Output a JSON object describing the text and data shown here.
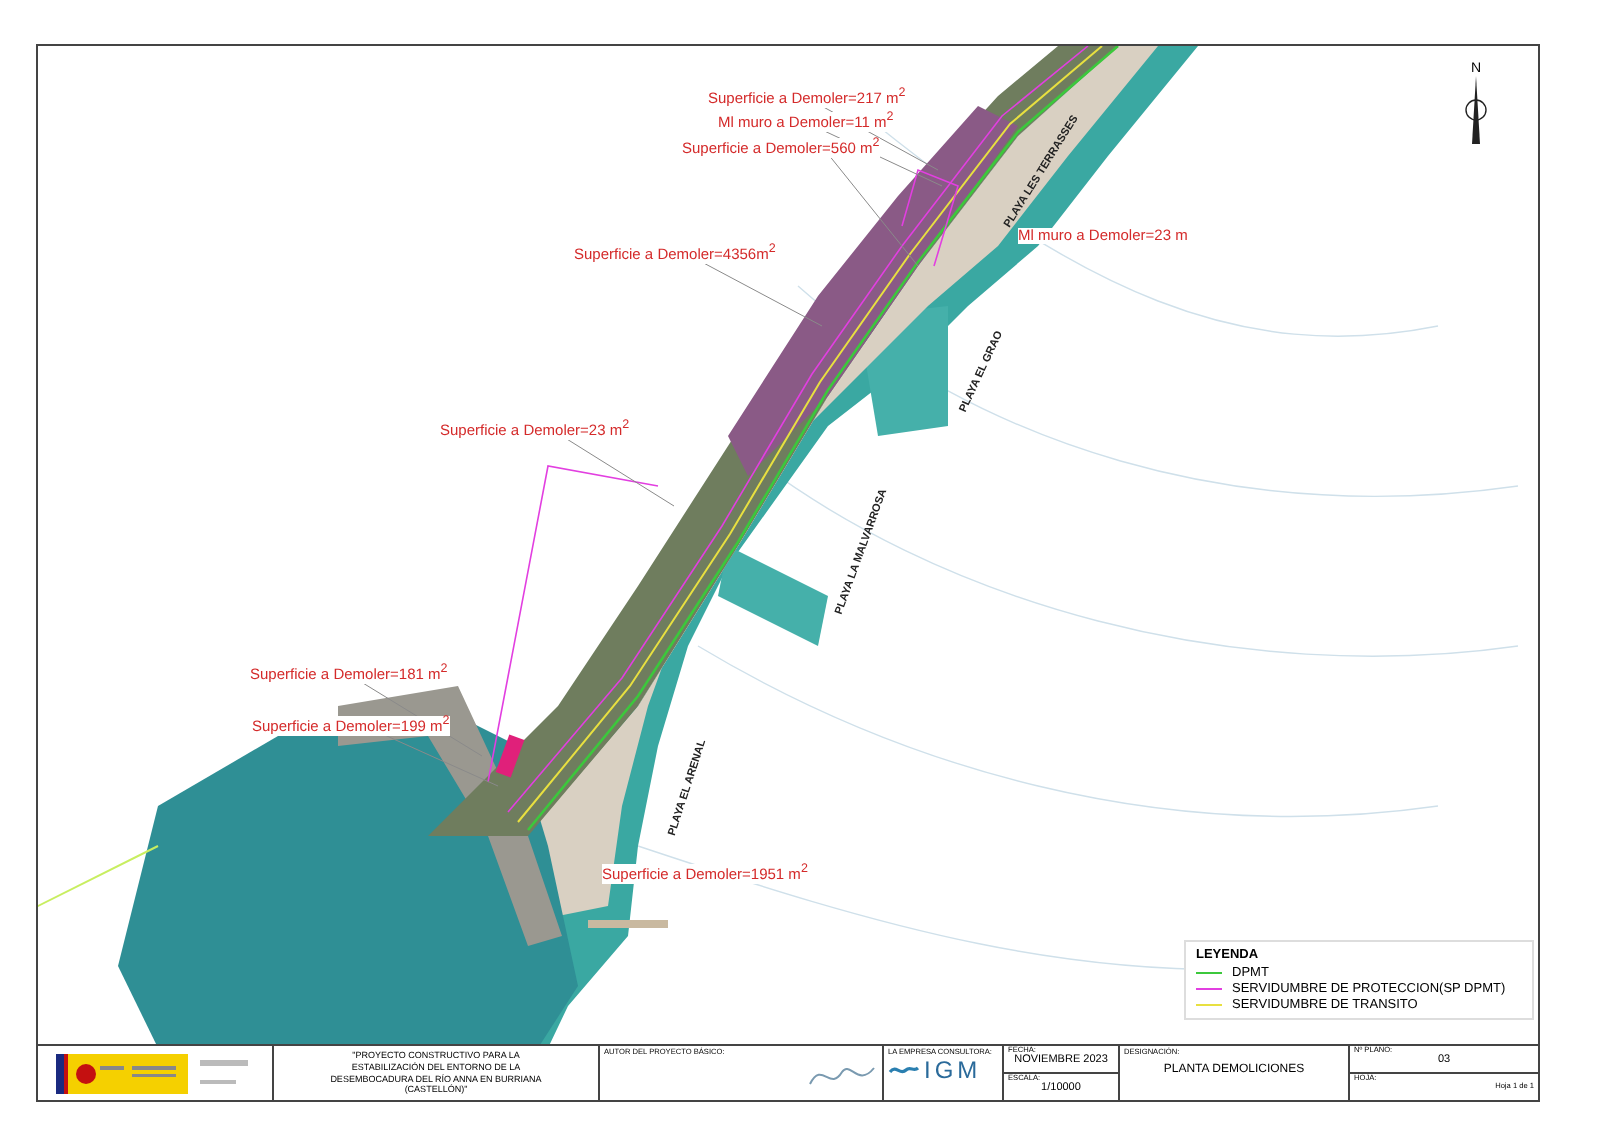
{
  "map": {
    "north_label": "N",
    "annotations": [
      {
        "text": "Superficie a Demoler=217 m$^{2}$"
      },
      {
        "text": "Ml muro a Demoler=11 m$^{2}$"
      },
      {
        "text": "Superficie a Demoler=560 m$^{2}$"
      },
      {
        "text": "Ml muro a Demoler=23 m"
      },
      {
        "text": "Superficie a Demoler=4356m$^{2}$"
      },
      {
        "text": "Superficie a Demoler=23 m$^{2}$"
      },
      {
        "text": "Superficie a Demoler=181 m$^{2}$"
      },
      {
        "text": "Superficie a Demoler=199 m$^{2}$"
      },
      {
        "text": "Superficie a Demoler=1951 m$^{2}$"
      }
    ],
    "beach_names": [
      "PLAYA LES TERRASSES",
      "PLAYA EL GRAO",
      "PLAYA LA MALVARROSA",
      "PLAYA EL ARENAL"
    ]
  },
  "legend": {
    "title": "LEYENDA",
    "items": [
      {
        "label": "DPMT",
        "color": "#3cc83c"
      },
      {
        "label": "SERVIDUMBRE DE PROTECCION(SP DPMT)",
        "color": "#e23fe0"
      },
      {
        "label": "SERVIDUMBRE DE TRANSITO",
        "color": "#e8e040"
      }
    ]
  },
  "title_block": {
    "project": "\"PROYECTO CONSTRUCTIVO PARA LA ESTABILIZACIÓN DEL ENTORNO DE LA DESEMBOCADURA DEL RÍO ANNA EN BURRIANA (CASTELLÓN)\"",
    "author_label": "AUTOR DEL PROYECTO BÁSICO:",
    "company_label": "LA EMPRESA CONSULTORA:",
    "company_name": "IGM",
    "date_label": "FECHA:",
    "date": "NOVIEMBRE 2023",
    "scale_label": "ESCALA:",
    "scale": "1/10000",
    "designation_label": "DESIGNACIÓN:",
    "designation": "PLANTA DEMOLICIONES",
    "plan_number_label": "Nº PLANO:",
    "plan_number": "03",
    "sheet_label": "HOJA:",
    "sheet": "Hoja 1 de 1"
  }
}
